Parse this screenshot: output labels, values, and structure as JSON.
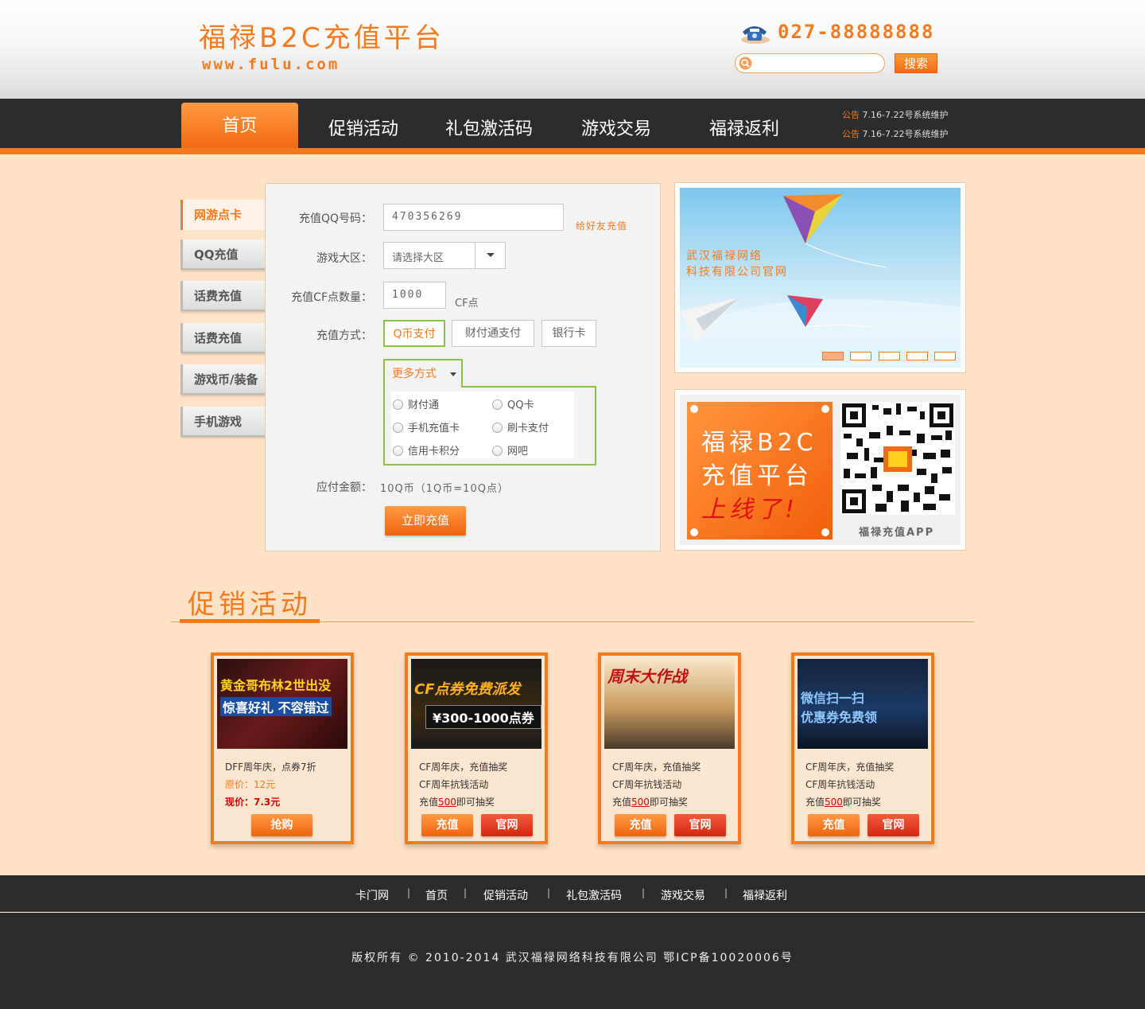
{
  "header": {
    "logo_title": "福禄B2C充值平台",
    "logo_url": "www.fulu.com",
    "phone": "027-88888888",
    "search_placeholder": "",
    "search_button": "搜索"
  },
  "nav": {
    "items": [
      "首页",
      "促销活动",
      "礼包激活码",
      "游戏交易",
      "福禄返利"
    ],
    "notices": [
      {
        "tag": "公告",
        "text": "7.16-7.22号系统维护"
      },
      {
        "tag": "公告",
        "text": "7.16-7.22号系统维护"
      }
    ]
  },
  "side_tabs": [
    "网游点卡",
    "QQ充值",
    "话费充值",
    "话费充值",
    "游戏币/装备",
    "手机游戏"
  ],
  "form": {
    "qq_label": "充值QQ号码：",
    "qq_value": "470356269",
    "friend_link": "给好友充值",
    "region_label": "游戏大区：",
    "region_value": "请选择大区",
    "points_label": "充值CF点数量：",
    "points_value": "1000",
    "points_unit": "CF点",
    "method_label": "充值方式：",
    "methods": [
      "Q币支付",
      "财付通支付",
      "银行卡"
    ],
    "more_label": "更多方式",
    "more_options": [
      "财付通",
      "QQ卡",
      "手机充值卡",
      "刷卡支付",
      "信用卡积分",
      "网吧"
    ],
    "amount_label": "应付金额：",
    "amount_value": "10Q币（1Q币=10Q点）",
    "submit": "立即充值"
  },
  "banner": {
    "text_line1": "武汉福禄网络",
    "text_line2": "科技有限公司官网",
    "slide_count": 5,
    "active_slide": 1
  },
  "app_promo": {
    "line1": "福禄B2C",
    "line2": "充值平台",
    "line3": "上线了!",
    "caption": "福禄充值APP"
  },
  "promo": {
    "heading": "促销活动",
    "cards": [
      {
        "image_caption_1": "黄金哥布林2世出没",
        "image_caption_2": "惊喜好礼 不容错过",
        "line1": "DFF周年庆，点券7折",
        "line2": "原价：12元",
        "line3": "现价：7.3元",
        "buttons": [
          "抢购"
        ]
      },
      {
        "image_caption_1": "CF点券免费派发",
        "image_caption_2": "¥300-1000点券",
        "line1": "CF周年庆，充值抽奖",
        "line2": "CF周年抗钱活动",
        "line3_pre": "充值",
        "line3_num": "500",
        "line3_post": "即可抽奖",
        "buttons": [
          "充值",
          "官网"
        ]
      },
      {
        "image_caption_1": "周末大作战",
        "image_caption_2": "",
        "line1": "CF周年庆，充值抽奖",
        "line2": "CF周年抗钱活动",
        "line3_pre": "充值",
        "line3_num": "500",
        "line3_post": "即可抽奖",
        "buttons": [
          "充值",
          "官网"
        ]
      },
      {
        "image_caption_1": "微信扫一扫",
        "image_caption_2": "优惠券免费领",
        "line1": "CF周年庆，充值抽奖",
        "line2": "CF周年抗钱活动",
        "line3_pre": "充值",
        "line3_num": "500",
        "line3_post": "即可抽奖",
        "buttons": [
          "充值",
          "官网"
        ]
      }
    ]
  },
  "footer": {
    "links": [
      "卡门网",
      "首页",
      "促销活动",
      "礼包激活码",
      "游戏交易",
      "福禄返利"
    ],
    "separator": "|",
    "copyright": "版权所有 © 2010-2014 武汉福禄网络科技有限公司 鄂ICP备10020006号"
  },
  "colors": {
    "accent": "#f47a1e",
    "page_bg": "#ffe3c8",
    "nav_bg": "#2c2c2c",
    "pay_selected_border": "#8cc04a"
  }
}
